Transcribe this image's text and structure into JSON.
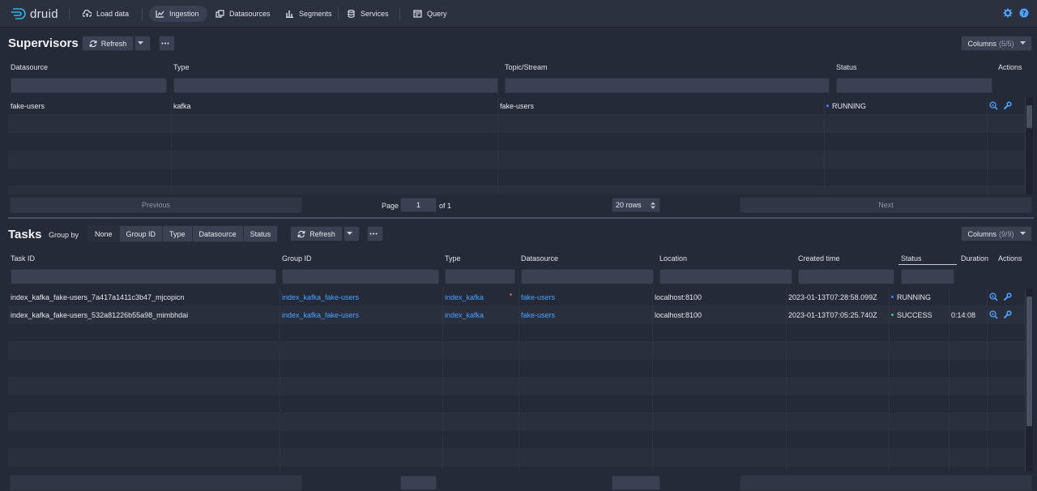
{
  "app": {
    "name": "druid"
  },
  "nav": {
    "load_data": "Load data",
    "ingestion": "Ingestion",
    "datasources": "Datasources",
    "segments": "Segments",
    "services": "Services",
    "query": "Query"
  },
  "supervisors": {
    "title": "Supervisors",
    "refresh_label": "Refresh",
    "columns_label": "Columns",
    "columns_count": "(5/5)",
    "headers": [
      "Datasource",
      "Type",
      "Topic/Stream",
      "Status",
      "Actions"
    ],
    "rows": [
      {
        "datasource": "fake-users",
        "type": "kafka",
        "topic": "fake-users",
        "status": "RUNNING",
        "status_color": "#2f8cff"
      }
    ],
    "pagination": {
      "previous": "Previous",
      "page_label": "Page",
      "page_value": "1",
      "of_label": "of 1",
      "rows_label": "20 rows",
      "next": "Next"
    }
  },
  "tasks": {
    "title": "Tasks",
    "group_by_label": "Group by",
    "group_by_options": [
      "None",
      "Group ID",
      "Type",
      "Datasource",
      "Status"
    ],
    "group_by_selected": "None",
    "refresh_label": "Refresh",
    "columns_label": "Columns",
    "columns_count": "(9/9)",
    "headers": [
      "Task ID",
      "Group ID",
      "Type",
      "Datasource",
      "Location",
      "Created time",
      "Status",
      "Duration",
      "Actions"
    ],
    "rows": [
      {
        "task_id": "index_kafka_fake-users_7a417a1411c3b47_mjcopicn",
        "group_id": "index_kafka_fake-users",
        "type": "index_kafka",
        "datasource": "fake-users",
        "location": "localhost:8100",
        "created": "2023-01-13T07:28:58.099Z",
        "status": "RUNNING",
        "status_color": "#2f8cff",
        "duration": ""
      },
      {
        "task_id": "index_kafka_fake-users_532a81226b55a98_mimbhdai",
        "group_id": "index_kafka_fake-users",
        "type": "index_kafka",
        "datasource": "fake-users",
        "location": "localhost:8100",
        "created": "2023-01-13T07:05:25.740Z",
        "status": "SUCCESS",
        "status_color": "#3ec46d",
        "duration": "0:14:08"
      }
    ]
  },
  "colors": {
    "accent": "#4aa3ff",
    "running": "#2f8cff",
    "success": "#3ec46d",
    "background": "#252a38"
  }
}
